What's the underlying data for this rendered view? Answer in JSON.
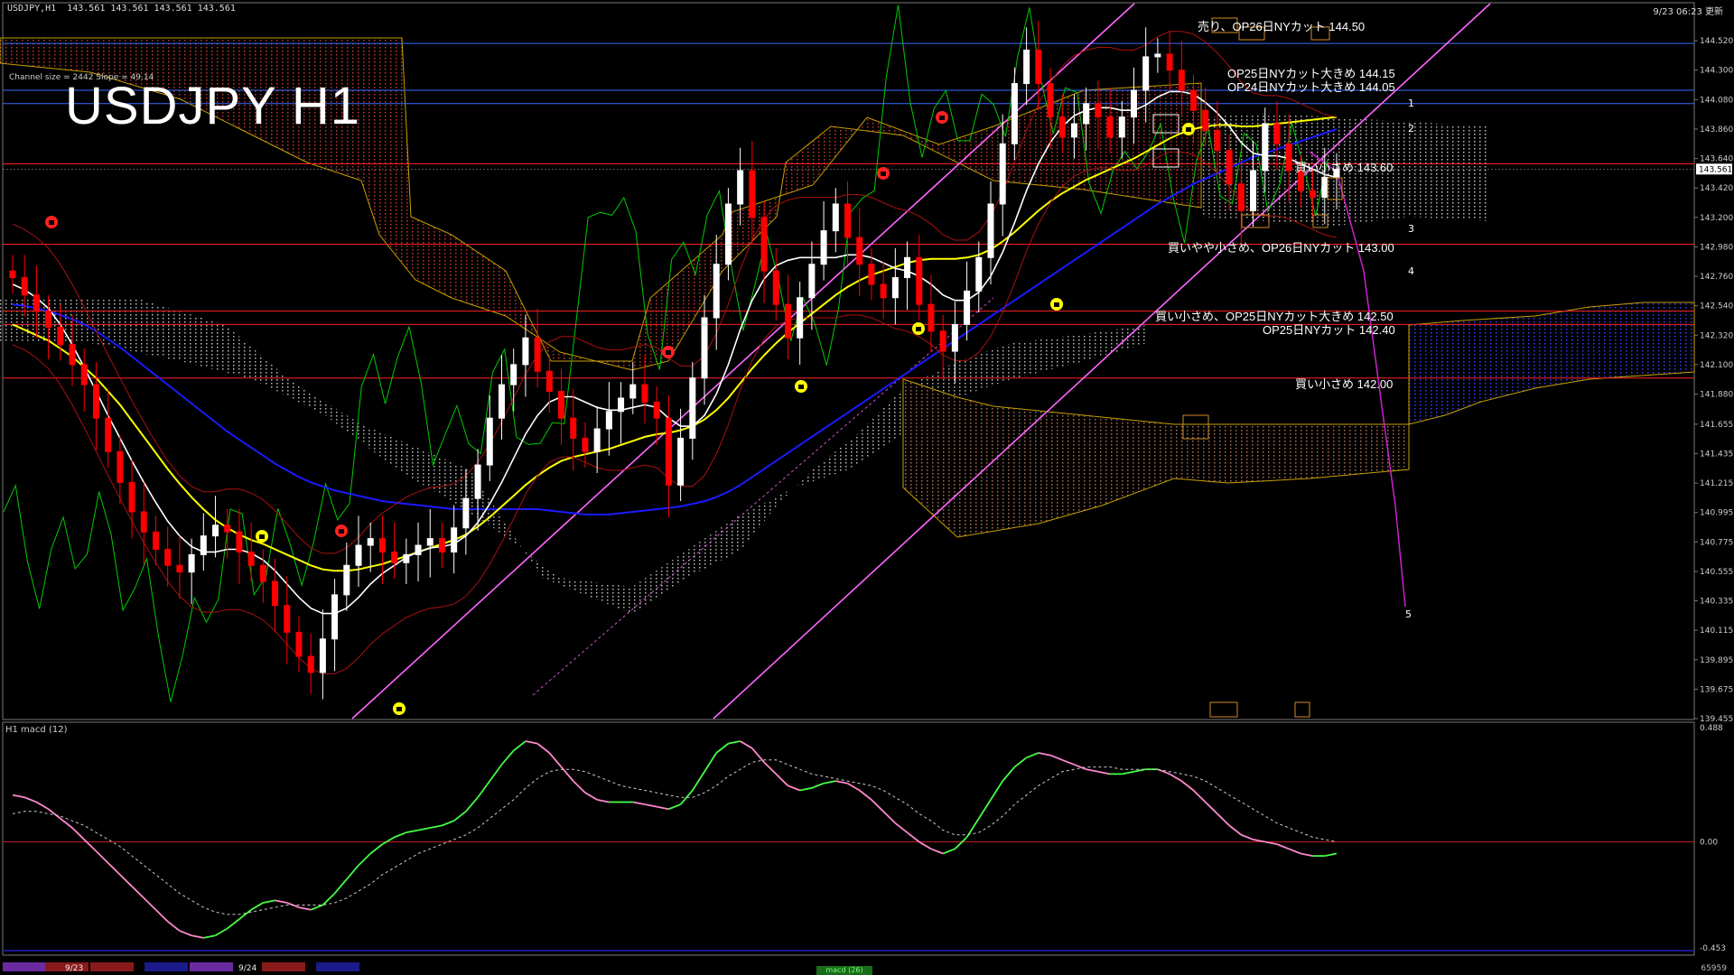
{
  "header": {
    "symbol_line": "USDJPY,H1  143.561 143.561 143.561 143.561",
    "datetime": "9/23 06:23 更新"
  },
  "channel_info": "Channel size = 2442 Slope = 49.14",
  "title": "USDJPY H1",
  "macd_title": "H1  macd (12)",
  "footer": {
    "date1": "9/23",
    "date2": "9/24",
    "right_label": "65959",
    "mid_tab": "macd (26)"
  },
  "levels": {
    "sell_14450": "売り、OP26日NYカット 144.50",
    "op_14415": "OP25日NYカット大きめ 144.15",
    "op_14405": "OP24日NYカット大きめ 144.05",
    "buy_14360": "買い小さめ 143.60",
    "buy_14300": "買いやや小さめ、OP26日NYカット 143.00",
    "buy_14250": "買い小さめ、OP25日NYカット大きめ 142.50",
    "op_14240": "OP25日NYカット 142.40",
    "buy_14200": "買い小さめ 142.00"
  },
  "wave_labels": [
    "1",
    "2",
    "3",
    "4",
    "5"
  ],
  "colors": {
    "background": "#000000",
    "bull_candle": "#ffffff",
    "bear_candle": "#ff0000",
    "sma_white": "#ffffff",
    "sma_yellow": "#ffff00",
    "sma_blue": "#1a1aff",
    "chikou": "#00cc00",
    "cloud_bull": "#ff7f7f",
    "cloud_bear": "#8f8fff",
    "channel": "#ff66ff",
    "level_line": "#ff2020",
    "macd_up": "#44ff44",
    "macd_down": "#ff88cc",
    "macd_signal": "#cccccc"
  },
  "chart_data": {
    "type": "candlestick",
    "title": "USDJPY H1",
    "y_axis": {
      "ylim": [
        139.455,
        144.73
      ],
      "ticks": [
        "144.520",
        "144.300",
        "144.080",
        "143.860",
        "143.640",
        "143.420",
        "143.200",
        "142.980",
        "142.760",
        "142.540",
        "142.320",
        "142.100",
        "141.880",
        "141.655",
        "141.435",
        "141.215",
        "140.995",
        "140.775",
        "140.555",
        "140.335",
        "140.115",
        "139.895",
        "139.675",
        "139.455"
      ],
      "current_price": "143.561"
    },
    "levels": [
      144.5,
      144.15,
      144.05,
      143.6,
      143.0,
      142.5,
      142.4,
      142.0
    ],
    "closes": [
      142.75,
      142.62,
      142.5,
      142.38,
      142.25,
      142.1,
      141.95,
      141.7,
      141.45,
      141.22,
      141.0,
      140.85,
      140.72,
      140.6,
      140.55,
      140.68,
      140.82,
      140.9,
      140.85,
      140.7,
      140.6,
      140.48,
      140.3,
      140.1,
      139.92,
      139.8,
      140.05,
      140.38,
      140.6,
      140.75,
      140.8,
      140.7,
      140.62,
      140.68,
      140.75,
      140.8,
      140.7,
      140.88,
      141.1,
      141.35,
      141.7,
      141.95,
      142.1,
      142.3,
      142.05,
      141.9,
      141.7,
      141.55,
      141.45,
      141.62,
      141.75,
      141.85,
      141.95,
      141.82,
      141.7,
      141.2,
      141.55,
      142.0,
      142.45,
      142.85,
      143.3,
      143.55,
      143.2,
      142.8,
      142.55,
      142.3,
      142.6,
      142.85,
      143.1,
      143.3,
      143.05,
      142.85,
      142.7,
      142.6,
      142.75,
      142.9,
      142.55,
      142.35,
      142.2,
      142.4,
      142.65,
      142.9,
      143.3,
      143.75,
      144.2,
      144.45,
      144.2,
      143.95,
      143.8,
      143.9,
      144.05,
      143.95,
      143.8,
      143.95,
      144.15,
      144.4,
      144.42,
      144.3,
      144.15,
      144.0,
      143.85,
      143.7,
      143.45,
      143.25,
      143.55,
      143.9,
      143.75,
      143.55,
      143.4,
      143.35,
      143.5,
      143.56
    ],
    "sma_white": [
      142.7,
      142.66,
      142.6,
      142.52,
      142.4,
      142.25,
      142.08,
      141.9,
      141.72,
      141.55,
      141.38,
      141.22,
      141.07,
      140.93,
      140.82,
      140.74,
      140.7,
      140.7,
      140.72,
      140.72,
      140.69,
      140.64,
      140.56,
      140.46,
      140.36,
      140.28,
      140.24,
      140.24,
      140.28,
      140.36,
      140.46,
      140.54,
      140.6,
      140.66,
      140.7,
      140.73,
      140.74,
      140.76,
      140.82,
      140.92,
      141.06,
      141.22,
      141.4,
      141.58,
      141.72,
      141.82,
      141.86,
      141.86,
      141.82,
      141.78,
      141.76,
      141.76,
      141.78,
      141.8,
      141.78,
      141.7,
      141.64,
      141.64,
      141.72,
      141.88,
      142.1,
      142.36,
      142.58,
      142.74,
      142.84,
      142.88,
      142.9,
      142.9,
      142.9,
      142.9,
      142.92,
      142.92,
      142.9,
      142.86,
      142.82,
      142.8,
      142.76,
      142.7,
      142.62,
      142.58,
      142.58,
      142.64,
      142.76,
      142.94,
      143.16,
      143.4,
      143.6,
      143.76,
      143.88,
      143.96,
      144.0,
      144.02,
      144.02,
      144.0,
      144.0,
      144.04,
      144.1,
      144.14,
      144.14,
      144.12,
      144.06,
      143.98,
      143.88,
      143.76,
      143.68,
      143.66,
      143.66,
      143.64,
      143.6,
      143.56,
      143.52,
      143.5
    ],
    "sma_yellow": [
      142.4,
      142.36,
      142.32,
      142.28,
      142.22,
      142.16,
      142.08,
      142.0,
      141.9,
      141.8,
      141.68,
      141.56,
      141.44,
      141.32,
      141.21,
      141.11,
      141.02,
      140.94,
      140.88,
      140.83,
      140.79,
      140.76,
      140.72,
      140.68,
      140.64,
      140.6,
      140.57,
      140.56,
      140.56,
      140.57,
      140.59,
      140.61,
      140.64,
      140.67,
      140.7,
      140.73,
      140.76,
      140.79,
      140.83,
      140.89,
      140.96,
      141.04,
      141.12,
      141.2,
      141.27,
      141.33,
      141.38,
      141.41,
      141.43,
      141.45,
      141.47,
      141.5,
      141.53,
      141.56,
      141.58,
      141.59,
      141.61,
      141.64,
      141.69,
      141.76,
      141.85,
      141.96,
      142.07,
      142.17,
      142.26,
      142.34,
      142.41,
      142.48,
      142.55,
      142.62,
      142.68,
      142.73,
      142.77,
      142.8,
      142.83,
      142.86,
      142.88,
      142.89,
      142.89,
      142.89,
      142.9,
      142.92,
      142.96,
      143.02,
      143.09,
      143.17,
      143.25,
      143.32,
      143.38,
      143.43,
      143.48,
      143.52,
      143.56,
      143.6,
      143.64,
      143.69,
      143.74,
      143.79,
      143.83,
      143.86,
      143.88,
      143.89,
      143.89,
      143.88,
      143.88,
      143.89,
      143.9,
      143.91,
      143.92,
      143.93,
      143.94,
      143.95
    ],
    "sma_blue": [
      142.55,
      142.54,
      142.52,
      142.5,
      142.47,
      142.44,
      142.4,
      142.35,
      142.29,
      142.23,
      142.16,
      142.09,
      142.02,
      141.95,
      141.88,
      141.81,
      141.74,
      141.67,
      141.6,
      141.54,
      141.48,
      141.42,
      141.36,
      141.31,
      141.26,
      141.22,
      141.19,
      141.16,
      141.14,
      141.12,
      141.1,
      141.08,
      141.07,
      141.06,
      141.05,
      141.04,
      141.03,
      141.02,
      141.02,
      141.02,
      141.02,
      141.02,
      141.02,
      141.02,
      141.02,
      141.01,
      141.0,
      140.99,
      140.98,
      140.98,
      140.98,
      140.99,
      141.0,
      141.01,
      141.02,
      141.03,
      141.04,
      141.06,
      141.08,
      141.11,
      141.15,
      141.2,
      141.26,
      141.32,
      141.38,
      141.44,
      141.5,
      141.56,
      141.62,
      141.68,
      141.74,
      141.8,
      141.86,
      141.92,
      141.98,
      142.04,
      142.1,
      142.16,
      142.22,
      142.28,
      142.34,
      142.4,
      142.46,
      142.52,
      142.58,
      142.64,
      142.7,
      142.76,
      142.82,
      142.88,
      142.94,
      143.0,
      143.06,
      143.12,
      143.18,
      143.24,
      143.3,
      143.35,
      143.4,
      143.45,
      143.49,
      143.53,
      143.57,
      143.61,
      143.65,
      143.68,
      143.71,
      143.74,
      143.77,
      143.8,
      143.83,
      143.86
    ],
    "macd": [
      0.2,
      0.19,
      0.17,
      0.14,
      0.1,
      0.06,
      0.01,
      -0.04,
      -0.09,
      -0.14,
      -0.19,
      -0.24,
      -0.29,
      -0.34,
      -0.38,
      -0.4,
      -0.41,
      -0.4,
      -0.37,
      -0.33,
      -0.29,
      -0.26,
      -0.25,
      -0.26,
      -0.28,
      -0.29,
      -0.27,
      -0.22,
      -0.16,
      -0.1,
      -0.05,
      -0.01,
      0.02,
      0.04,
      0.05,
      0.06,
      0.07,
      0.09,
      0.13,
      0.19,
      0.26,
      0.33,
      0.39,
      0.43,
      0.42,
      0.38,
      0.32,
      0.26,
      0.21,
      0.18,
      0.17,
      0.17,
      0.17,
      0.16,
      0.15,
      0.14,
      0.16,
      0.22,
      0.3,
      0.38,
      0.42,
      0.43,
      0.4,
      0.34,
      0.29,
      0.24,
      0.22,
      0.23,
      0.25,
      0.26,
      0.25,
      0.22,
      0.18,
      0.13,
      0.08,
      0.04,
      0.0,
      -0.03,
      -0.05,
      -0.03,
      0.02,
      0.1,
      0.18,
      0.26,
      0.32,
      0.36,
      0.38,
      0.37,
      0.35,
      0.33,
      0.31,
      0.3,
      0.29,
      0.29,
      0.3,
      0.31,
      0.31,
      0.29,
      0.26,
      0.22,
      0.17,
      0.12,
      0.07,
      0.03,
      0.01,
      0.0,
      -0.01,
      -0.03,
      -0.05,
      -0.06,
      -0.06,
      -0.05
    ],
    "macd_signal": [
      0.12,
      0.13,
      0.13,
      0.12,
      0.11,
      0.09,
      0.07,
      0.04,
      0.01,
      -0.02,
      -0.06,
      -0.1,
      -0.14,
      -0.18,
      -0.22,
      -0.25,
      -0.28,
      -0.3,
      -0.31,
      -0.31,
      -0.3,
      -0.29,
      -0.28,
      -0.27,
      -0.27,
      -0.27,
      -0.27,
      -0.26,
      -0.24,
      -0.21,
      -0.18,
      -0.14,
      -0.11,
      -0.08,
      -0.05,
      -0.03,
      -0.01,
      0.01,
      0.03,
      0.06,
      0.1,
      0.14,
      0.18,
      0.23,
      0.27,
      0.3,
      0.31,
      0.31,
      0.3,
      0.28,
      0.26,
      0.24,
      0.23,
      0.22,
      0.21,
      0.2,
      0.19,
      0.19,
      0.21,
      0.24,
      0.28,
      0.31,
      0.34,
      0.35,
      0.35,
      0.33,
      0.31,
      0.29,
      0.28,
      0.27,
      0.26,
      0.25,
      0.24,
      0.22,
      0.19,
      0.16,
      0.12,
      0.09,
      0.05,
      0.03,
      0.03,
      0.04,
      0.07,
      0.11,
      0.16,
      0.2,
      0.24,
      0.27,
      0.3,
      0.31,
      0.32,
      0.32,
      0.32,
      0.31,
      0.31,
      0.31,
      0.31,
      0.3,
      0.29,
      0.28,
      0.26,
      0.23,
      0.2,
      0.17,
      0.14,
      0.11,
      0.08,
      0.06,
      0.04,
      0.02,
      0.01,
      0.0
    ],
    "macd_axis": {
      "ylim": [
        -0.453,
        0.488
      ],
      "ticks": [
        "0.488",
        "0.00",
        "-0.453"
      ]
    }
  }
}
